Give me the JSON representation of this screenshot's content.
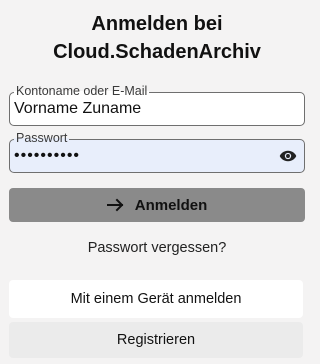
{
  "title": "Anmelden bei\nCloud.SchadenArchiv",
  "username": {
    "label": "Kontoname oder E-Mail",
    "value": "Vorname Zuname"
  },
  "password": {
    "label": "Passwort",
    "value": "••••••••••",
    "toggle_icon": "eye-icon"
  },
  "login_button": {
    "label": "Anmelden",
    "icon": "arrow-right-icon"
  },
  "forgot_link": "Passwort vergessen?",
  "device_button": "Mit einem Gerät anmelden",
  "register_button": "Registrieren",
  "colors": {
    "background": "#f4f3f3",
    "login_button_bg": "#8a8a8a",
    "password_field_bg": "#e8eefb"
  }
}
